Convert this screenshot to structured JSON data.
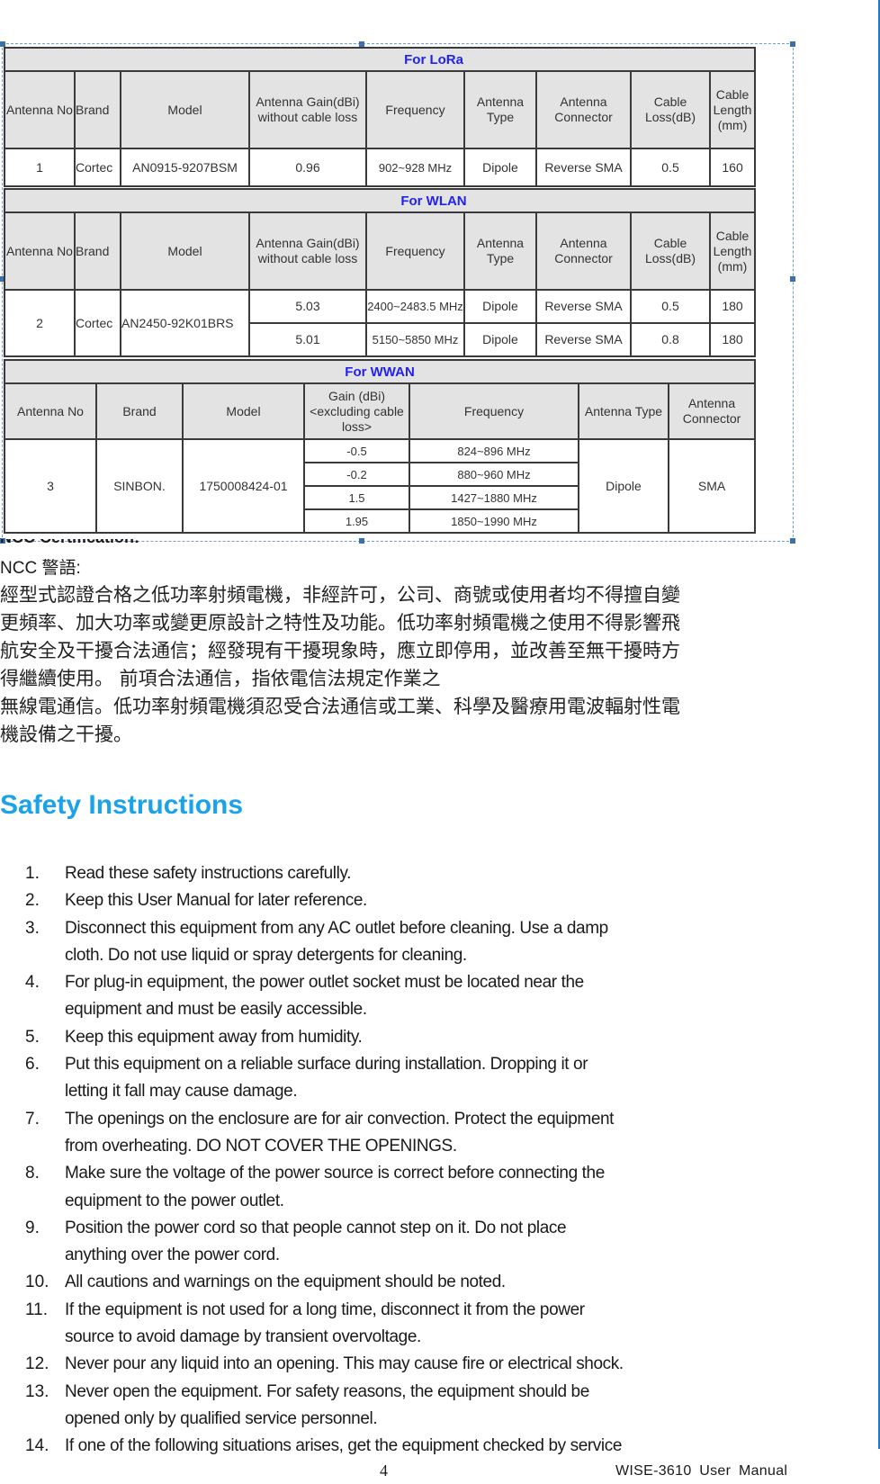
{
  "antenna_tables": {
    "lora": {
      "section": "For LoRa",
      "headers": [
        "Antenna No",
        "Brand",
        "Model",
        "Antenna Gain(dBi) without cable loss",
        "Frequency",
        "Antenna Type",
        "Antenna Connector",
        "Cable Loss(dB)",
        "Cable Length (mm)"
      ],
      "rows": [
        {
          "no": "1",
          "brand": "Cortec",
          "model": "AN0915-9207BSM",
          "gain": "0.96",
          "frequency": "902~928 MHz",
          "type": "Dipole",
          "connector": "Reverse SMA",
          "cable_loss": "0.5",
          "cable_length": "160"
        }
      ]
    },
    "wlan": {
      "section": "For WLAN",
      "headers": [
        "Antenna No",
        "Brand",
        "Model",
        "Antenna Gain(dBi) without cable loss",
        "Frequency",
        "Antenna Type",
        "Antenna Connector",
        "Cable Loss(dB)",
        "Cable Length (mm)"
      ],
      "no": "2",
      "brand": "Cortec",
      "model": "AN2450-92K01BRS",
      "rows": [
        {
          "gain": "5.03",
          "frequency": "2400~2483.5 MHz",
          "type": "Dipole",
          "connector": "Reverse SMA",
          "cable_loss": "0.5",
          "cable_length": "180"
        },
        {
          "gain": "5.01",
          "frequency": "5150~5850 MHz",
          "type": "Dipole",
          "connector": "Reverse SMA",
          "cable_loss": "0.8",
          "cable_length": "180"
        }
      ]
    },
    "wwan": {
      "section": "For WWAN",
      "headers": [
        "Antenna No",
        "Brand",
        "Model",
        "Gain (dBi) <excluding cable loss>",
        "Frequency",
        "Antenna Type",
        "Antenna Connector"
      ],
      "no": "3",
      "brand": "SINBON.",
      "model": "1750008424-01",
      "type": "Dipole",
      "connector": "SMA",
      "rows": [
        {
          "gain": "-0.5",
          "frequency": "824~896 MHz"
        },
        {
          "gain": "-0.2",
          "frequency": "880~960 MHz"
        },
        {
          "gain": "1.5",
          "frequency": "1427~1880 MHz"
        },
        {
          "gain": "1.95",
          "frequency": "1850~1990 MHz"
        }
      ]
    }
  },
  "ncc": {
    "clipped_heading": "NCC Certification:",
    "title": "NCC  警語:",
    "lines": [
      "經型式認證合格之低功率射頻電機，非經許可，公司、商號或使用者均不得擅自變",
      "更頻率、加大功率或變更原設計之特性及功能。低功率射頻電機之使用不得影響飛",
      "航安全及干擾合法通信；經發現有干擾現象時，應立即停用，並改善至無干擾時方",
      "得繼續使用。  前項合法通信，指依電信法規定作業之",
      "無線電通信。低功率射頻電機須忍受合法通信或工業、科學及醫療用電波輻射性電",
      "機設備之干擾。"
    ]
  },
  "safety": {
    "title": "Safety Instructions",
    "items": [
      {
        "num": "1.",
        "lines": [
          "Read these safety instructions carefully."
        ]
      },
      {
        "num": "2.",
        "lines": [
          "Keep this User Manual for later reference."
        ]
      },
      {
        "num": "3.",
        "lines": [
          "Disconnect this equipment from any AC outlet before cleaning. Use a damp",
          "cloth. Do not use liquid or spray detergents for cleaning."
        ]
      },
      {
        "num": "4.",
        "lines": [
          "For plug-in equipment, the power outlet socket must be located near the",
          "equipment and must be easily accessible."
        ]
      },
      {
        "num": "5.",
        "lines": [
          "Keep this equipment away from humidity."
        ]
      },
      {
        "num": "6.",
        "lines": [
          "Put this equipment on a reliable surface during installation. Dropping it or",
          "letting it fall may cause damage."
        ]
      },
      {
        "num": "7.",
        "lines": [
          "The openings on the enclosure are for air convection. Protect the equipment",
          "from overheating. DO NOT COVER THE OPENINGS."
        ]
      },
      {
        "num": "8.",
        "lines": [
          "Make sure the voltage of the power source is correct before connecting the",
          "equipment to the power outlet."
        ]
      },
      {
        "num": "9.",
        "lines": [
          "Position the power cord so that people cannot step on it. Do not place",
          "anything over the power cord."
        ]
      },
      {
        "num": "10.",
        "lines": [
          "All cautions and warnings on the equipment should be noted."
        ]
      },
      {
        "num": "11.",
        "lines": [
          "If the equipment is not used for a long time, disconnect it from the power",
          "source to avoid damage by transient overvoltage."
        ]
      },
      {
        "num": "12.",
        "lines": [
          "Never pour any liquid into an opening. This may cause fire or electrical shock."
        ]
      },
      {
        "num": "13.",
        "lines": [
          "Never open the equipment. For safety reasons, the equipment should be",
          "opened only by qualified service personnel."
        ]
      },
      {
        "num": "14.",
        "lines": [
          "If one of the following situations arises, get the equipment checked by service"
        ]
      }
    ]
  },
  "footer": {
    "page_number": "4",
    "doc_title": "WISE-3610  User  Manual"
  },
  "colors": {
    "heading_blue": "#1aa3e8",
    "table_section_blue": "#2222ee",
    "right_bar": "#1f78c8"
  }
}
